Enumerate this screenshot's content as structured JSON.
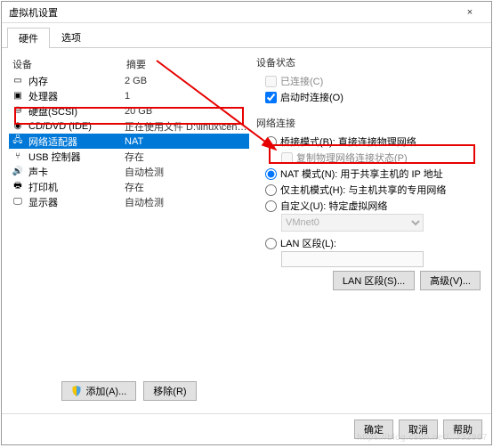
{
  "window": {
    "title": "虚拟机设置",
    "close_glyph": "×"
  },
  "tabs": {
    "hardware": "硬件",
    "options": "选项"
  },
  "columns": {
    "device": "设备",
    "summary": "摘要"
  },
  "devices": [
    {
      "icon": "memory-icon",
      "label": "内存",
      "summary": "2 GB"
    },
    {
      "icon": "cpu-icon",
      "label": "处理器",
      "summary": "1"
    },
    {
      "icon": "disk-icon",
      "label": "硬盘(SCSI)",
      "summary": "20 GB"
    },
    {
      "icon": "cd-icon",
      "label": "CD/DVD (IDE)",
      "summary": "正在使用文件 D:\\linux\\centos\\Cent..."
    },
    {
      "icon": "network-icon",
      "label": "网络适配器",
      "summary": "NAT",
      "selected": true
    },
    {
      "icon": "usb-icon",
      "label": "USB 控制器",
      "summary": "存在"
    },
    {
      "icon": "sound-icon",
      "label": "声卡",
      "summary": "自动检测"
    },
    {
      "icon": "printer-icon",
      "label": "打印机",
      "summary": "存在"
    },
    {
      "icon": "display-icon",
      "label": "显示器",
      "summary": "自动检测"
    }
  ],
  "left_buttons": {
    "add": "添加(A)...",
    "remove": "移除(R)"
  },
  "right": {
    "device_state": {
      "title": "设备状态",
      "connected": "已连接(C)",
      "connect_on_power": "启动时连接(O)"
    },
    "net": {
      "title": "网络连接",
      "bridged": "桥接模式(B): 直接连接物理网络",
      "replicate": "复制物理网络连接状态(P)",
      "nat": "NAT 模式(N): 用于共享主机的 IP 地址",
      "hostonly": "仅主机模式(H): 与主机共享的专用网络",
      "custom": "自定义(U): 特定虚拟网络",
      "vmnet_value": "VMnet0",
      "lan": "LAN 区段(L):",
      "lan_button": "LAN 区段(S)...",
      "advanced": "高级(V)..."
    }
  },
  "footer": {
    "ok": "确定",
    "cancel": "取消",
    "help": "帮助"
  },
  "colors": {
    "selection": "#0078d7",
    "annotation": "#e60000"
  }
}
